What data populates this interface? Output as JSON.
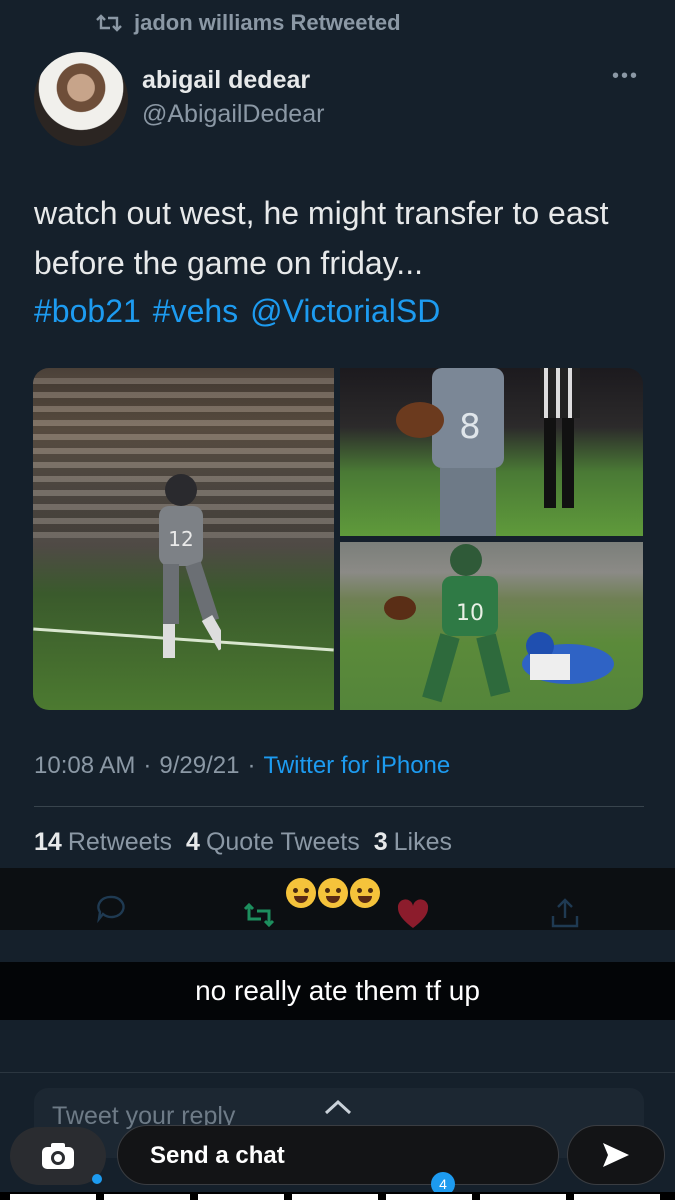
{
  "retweet_banner": {
    "text": "jadon williams Retweeted"
  },
  "tweet": {
    "display_name": "abigail dedear",
    "handle": "@AbigailDedear",
    "text": "watch out west, he might transfer to east before the game on friday...",
    "tags": [
      "#bob21",
      "#vehs",
      "@VictorialSD"
    ],
    "time": "10:08 AM",
    "date": "9/29/21",
    "source": "Twitter for iPhone",
    "stats": {
      "retweets_count": "14",
      "retweets_label": "Retweets",
      "quotes_count": "4",
      "quotes_label": "Quote Tweets",
      "likes_count": "3",
      "likes_label": "Likes"
    },
    "jersey_numbers": [
      "12",
      "8",
      "10"
    ]
  },
  "actions": {
    "reply_icon": "comment-icon",
    "retweet_icon": "retweet-icon",
    "like_icon": "heart-icon",
    "share_icon": "share-icon"
  },
  "snap_caption": "no really ate them tf up",
  "reply": {
    "placeholder": "Tweet your reply"
  },
  "chat": {
    "placeholder": "Send a chat",
    "badge": "4"
  },
  "colors": {
    "background": "#15202b",
    "accent": "#1d9bf0",
    "muted": "#8b98a5",
    "like": "#8c1c2c",
    "retweet": "#1d8f5e"
  }
}
